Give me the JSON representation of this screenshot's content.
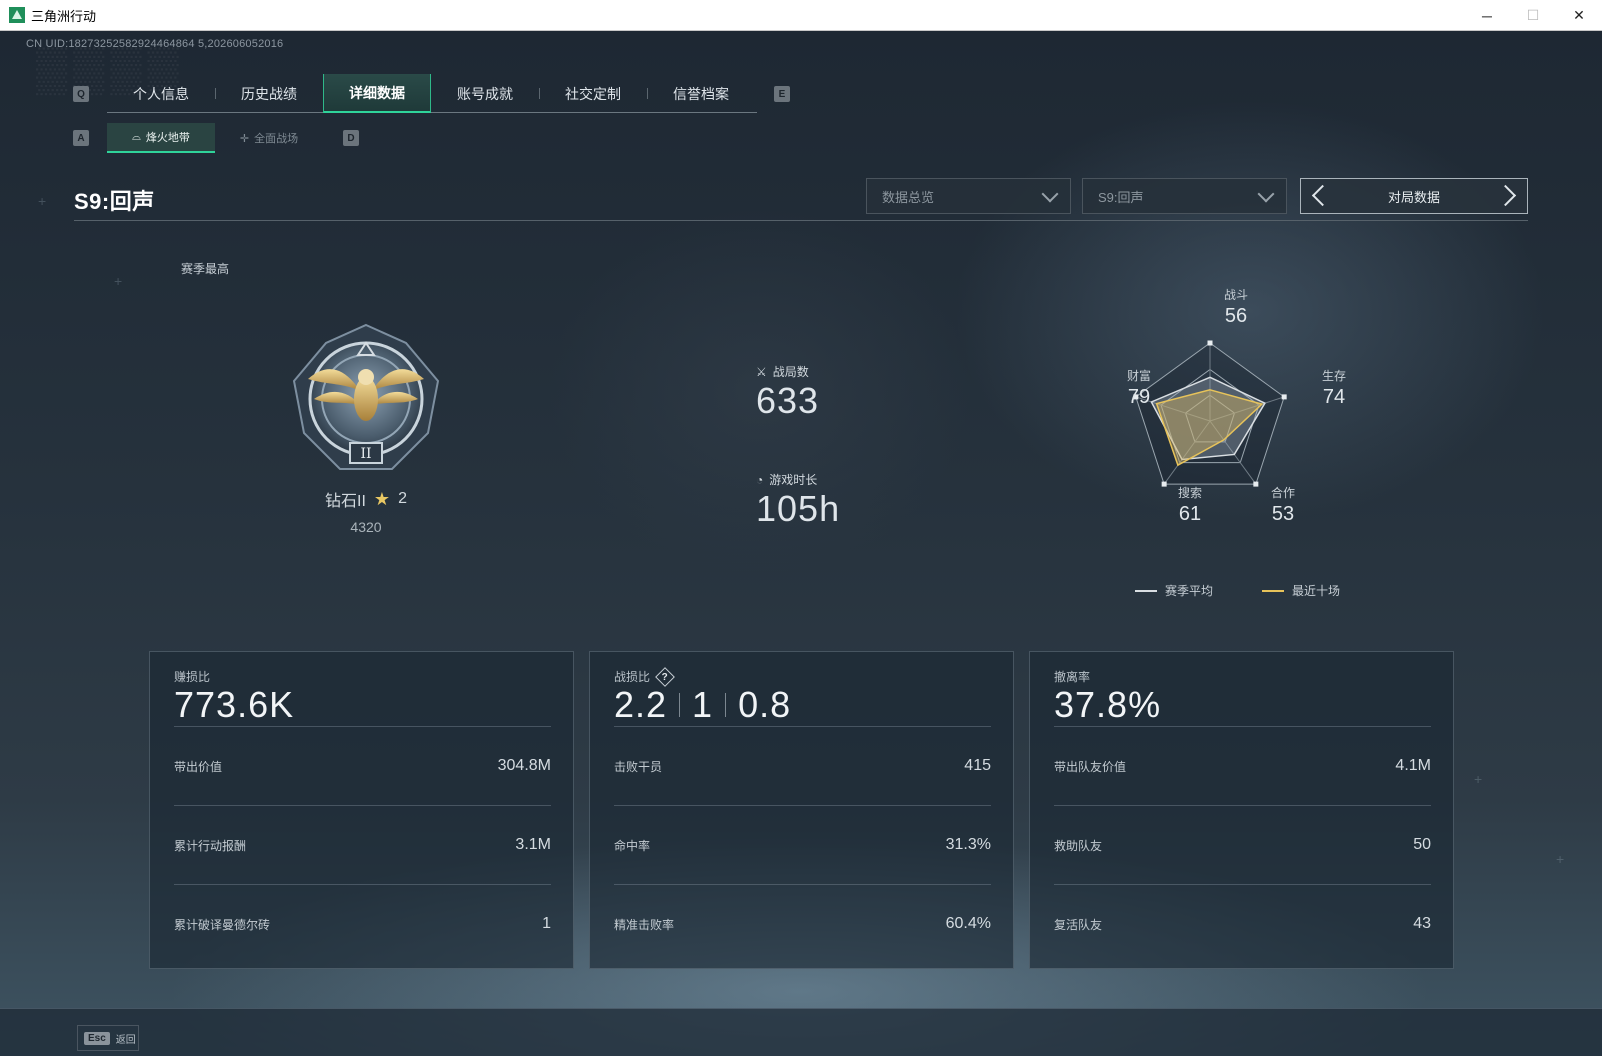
{
  "window": {
    "title": "三角洲行动",
    "minimize": "─",
    "maximize": "☐",
    "close": "✕"
  },
  "uid": "CN UID:18273252582924464864 5,202606052016",
  "nav": {
    "prev_key": "Q",
    "next_key": "E",
    "tabs": [
      "个人信息",
      "历史战绩",
      "详细数据",
      "账号成就",
      "社交定制",
      "信誉档案"
    ],
    "active_tab": "详细数据"
  },
  "subnav": {
    "prev_key": "A",
    "next_key": "D",
    "tabs": [
      "烽火地带",
      "全面战场"
    ],
    "active_tab": "烽火地带"
  },
  "season": {
    "title": "S9:回声"
  },
  "filters": {
    "dropdown_1": "数据总览",
    "dropdown_2": "S9:回声",
    "switcher_label": "对局数据"
  },
  "rank": {
    "caption": "赛季最高",
    "tier": "钻石II",
    "stars": "2",
    "score": "4320"
  },
  "overview": {
    "matches_label": "战局数",
    "matches_value": "633",
    "playtime_label": "游戏时长",
    "playtime_value": "105h"
  },
  "radar": {
    "axes": [
      {
        "label": "战斗",
        "value": "56"
      },
      {
        "label": "生存",
        "value": "74"
      },
      {
        "label": "合作",
        "value": "53"
      },
      {
        "label": "搜索",
        "value": "61"
      },
      {
        "label": "财富",
        "value": "79"
      }
    ],
    "season_avg_fractions": [
      0.56,
      0.74,
      0.53,
      0.61,
      0.79
    ],
    "recent_ten_fractions": [
      0.4,
      0.7,
      0.3,
      0.7,
      0.72
    ],
    "legend_season_avg": "赛季平均",
    "legend_recent": "最近十场",
    "season_avg_color": "#d9dee2",
    "recent_color": "#e7c35a"
  },
  "cards": {
    "profit": {
      "title": "赚损比",
      "value": "773.6K",
      "rows": [
        {
          "label": "带出价值",
          "value": "304.8M"
        },
        {
          "label": "累计行动报酬",
          "value": "3.1M"
        },
        {
          "label": "累计破译曼德尔砖",
          "value": "1"
        }
      ]
    },
    "kd": {
      "title": "战损比",
      "help_icon": "?",
      "values": [
        "2.2",
        "1",
        "0.8"
      ],
      "rows": [
        {
          "label": "击败干员",
          "value": "415"
        },
        {
          "label": "命中率",
          "value": "31.3%"
        },
        {
          "label": "精准击败率",
          "value": "60.4%"
        }
      ]
    },
    "extract": {
      "title": "撤离率",
      "value": "37.8%",
      "rows": [
        {
          "label": "带出队友价值",
          "value": "4.1M"
        },
        {
          "label": "救助队友",
          "value": "50"
        },
        {
          "label": "复活队友",
          "value": "43"
        }
      ]
    }
  },
  "footer": {
    "esc_key": "Esc",
    "back_label": "返回"
  },
  "colors": {
    "accent": "#2fd39a",
    "gold": "#e9c863"
  }
}
